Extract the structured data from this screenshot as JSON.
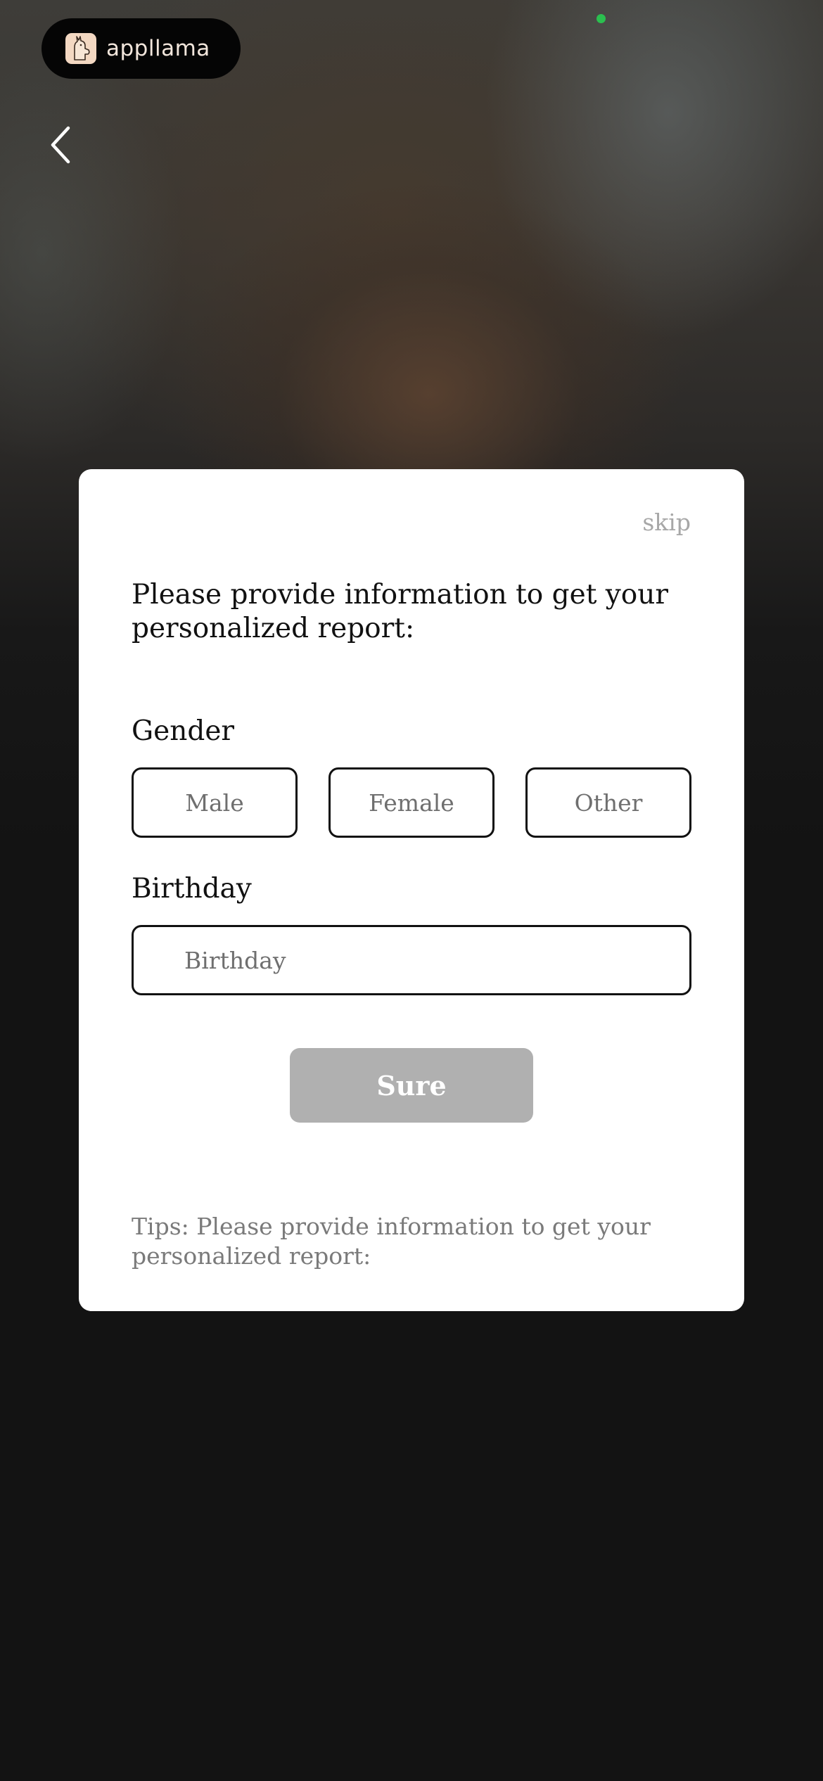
{
  "app": {
    "brand_name": "appllama",
    "brand_icon": "llama-icon"
  },
  "navigation": {
    "back_icon": "chevron-left-icon"
  },
  "dialog": {
    "skip_label": "skip",
    "title": "Please provide information to get your personalized report:",
    "gender": {
      "label": "Gender",
      "options": [
        "Male",
        "Female",
        "Other"
      ]
    },
    "birthday": {
      "label": "Birthday",
      "placeholder": "Birthday",
      "value": ""
    },
    "submit_label": "Sure",
    "tips": "Tips: Please provide information to get your personalized report:"
  },
  "colors": {
    "status_dot": "#2bbf4f",
    "submit_disabled": "#b0b0b0",
    "card_background": "#ffffff"
  }
}
